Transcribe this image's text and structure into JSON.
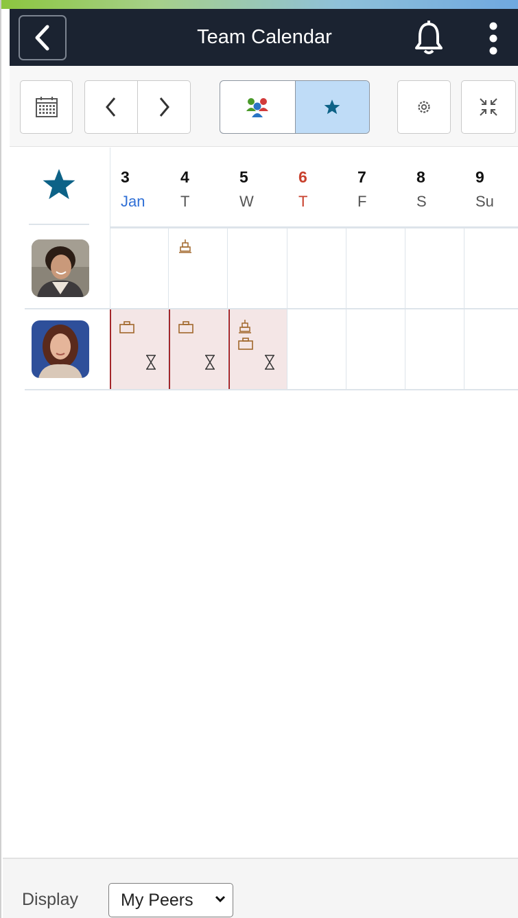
{
  "header": {
    "title": "Team Calendar"
  },
  "days": [
    {
      "num": "3",
      "sub": "Jan",
      "is_month": true,
      "is_today": false
    },
    {
      "num": "4",
      "sub": "T",
      "is_month": false,
      "is_today": false
    },
    {
      "num": "5",
      "sub": "W",
      "is_month": false,
      "is_today": false
    },
    {
      "num": "6",
      "sub": "T",
      "is_month": false,
      "is_today": true
    },
    {
      "num": "7",
      "sub": "F",
      "is_month": false,
      "is_today": false
    },
    {
      "num": "8",
      "sub": "S",
      "is_month": false,
      "is_today": false
    },
    {
      "num": "9",
      "sub": "Su",
      "is_month": false,
      "is_today": false
    }
  ],
  "rows": [
    {
      "avatar": "person-1-avatar",
      "events": {
        "1": [
          "holiday-icon"
        ]
      },
      "leave_days": []
    },
    {
      "avatar": "person-2-avatar",
      "events": {
        "0": [
          "leave-icon",
          "pending-icon"
        ],
        "1": [
          "leave-icon",
          "pending-icon"
        ],
        "2": [
          "holiday-icon",
          "leave-icon",
          "pending-icon"
        ]
      },
      "leave_days": [
        0,
        1,
        2
      ]
    }
  ],
  "footer": {
    "display_label": "Display",
    "display_value": "My Peers"
  },
  "colors": {
    "header_bg": "#1b2331",
    "accent_star": "#0d6287",
    "today": "#c8402c",
    "month": "#2f6fd6",
    "leave_bg": "#f4e6e6",
    "leave_border": "#a3262a",
    "event_icon": "#a0672a"
  }
}
